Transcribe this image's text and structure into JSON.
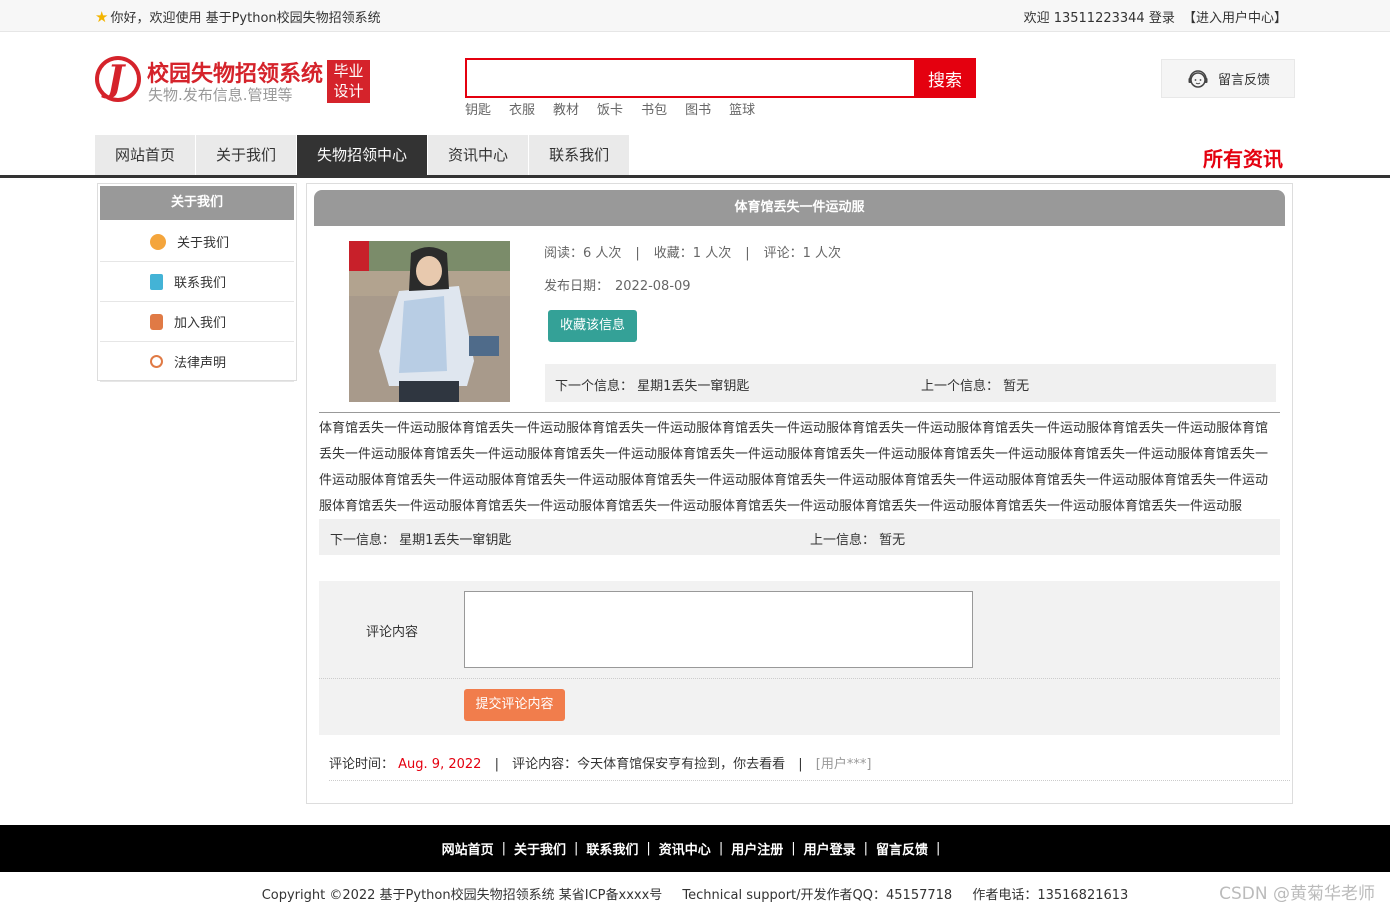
{
  "topbar": {
    "welcome": "你好，欢迎使用 基于Python校园失物招领系统",
    "user_greeting": "欢迎 13511223344 登录",
    "user_center": "【进入用户中心】"
  },
  "logo": {
    "mark": "J",
    "title": "校园失物招领系统",
    "subtitle": "失物.发布信息.管理等",
    "badge_line1": "毕业",
    "badge_line2": "设计"
  },
  "search": {
    "placeholder": "",
    "button": "搜索",
    "hotwords": [
      "钥匙",
      "衣服",
      "教材",
      "饭卡",
      "书包",
      "图书",
      "篮球"
    ]
  },
  "feedback": {
    "label": "留言反馈",
    "icon": "customer-service-icon"
  },
  "nav": {
    "items": [
      "网站首页",
      "关于我们",
      "失物招领中心",
      "资讯中心",
      "联系我们"
    ],
    "active": "失物招领中心",
    "all_news": "所有资讯"
  },
  "sidebar": {
    "title": "关于我们",
    "items": [
      {
        "label": "关于我们",
        "icon": "orange-circle-icon",
        "color": "#f4a53c"
      },
      {
        "label": "联系我们",
        "icon": "clipboard-icon",
        "color": "#43b3d6"
      },
      {
        "label": "加入我们",
        "icon": "lock-icon",
        "color": "#e07a45"
      },
      {
        "label": "法律声明",
        "icon": "power-icon",
        "color": "#e07a45"
      }
    ]
  },
  "article": {
    "title": "体育馆丢失一件运动服",
    "stats": {
      "read_label": "阅读：6 人次",
      "collect_label": "收藏：1 人次",
      "comment_label": "评论：1 人次"
    },
    "pubdate_label": "发布日期：",
    "pubdate": "2022-08-09",
    "collect_button": "收藏该信息",
    "next_label_top": "下一个信息：",
    "next_value": "星期1丢失一窜钥匙",
    "prev_label_top": "上一个信息：",
    "prev_value": "暂无",
    "body": "体育馆丢失一件运动服体育馆丢失一件运动服体育馆丢失一件运动服体育馆丢失一件运动服体育馆丢失一件运动服体育馆丢失一件运动服体育馆丢失一件运动服体育馆丢失一件运动服体育馆丢失一件运动服体育馆丢失一件运动服体育馆丢失一件运动服体育馆丢失一件运动服体育馆丢失一件运动服体育馆丢失一件运动服体育馆丢失一件运动服体育馆丢失一件运动服体育馆丢失一件运动服体育馆丢失一件运动服体育馆丢失一件运动服体育馆丢失一件运动服体育馆丢失一件运动服体育馆丢失一件运动服体育馆丢失一件运动服体育馆丢失一件运动服体育馆丢失一件运动服体育馆丢失一件运动服体育馆丢失一件运动服体育馆丢失一件运动服体育馆丢失一件运动服",
    "next_label_bottom": "下一信息：",
    "prev_label_bottom": "上一信息："
  },
  "comment_form": {
    "label": "评论内容",
    "submit": "提交评论内容"
  },
  "comments": [
    {
      "time_label": "评论时间：",
      "time": "Aug. 9, 2022",
      "content": "评论内容：今天体育馆保安亨有捡到，你去看看",
      "user": "[用户***]"
    }
  ],
  "footer": {
    "links": [
      "网站首页",
      "关于我们",
      "联系我们",
      "资讯中心",
      "用户注册",
      "用户登录",
      "留言反馈"
    ],
    "copyright": "Copyright ©2022 基于Python校园失物招领系统 某省ICP备xxxx号",
    "support": "Technical support/开发作者QQ：45157718",
    "phone": "作者电话：13516821613",
    "watermark": "CSDN @黄菊华老师"
  }
}
